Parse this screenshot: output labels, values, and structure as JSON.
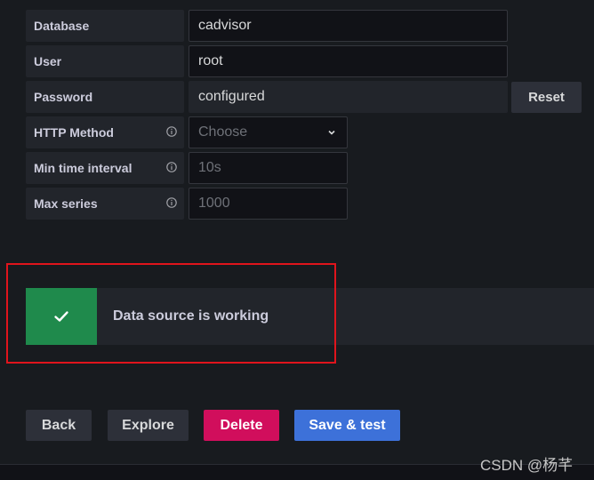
{
  "form": {
    "rows": [
      {
        "label": "Database",
        "value": "cadvisor"
      },
      {
        "label": "User",
        "value": "root"
      },
      {
        "label": "Password",
        "value": "configured"
      },
      {
        "label": "HTTP Method",
        "value": "Choose"
      },
      {
        "label": "Min time interval",
        "value": "10s"
      },
      {
        "label": "Max series",
        "value": "1000"
      }
    ],
    "reset_label": "Reset"
  },
  "alert": {
    "message": "Data source is working",
    "status_color": "#1f8a4c"
  },
  "actions": {
    "back": "Back",
    "explore": "Explore",
    "delete": "Delete",
    "save_test": "Save & test"
  },
  "watermark": "CSDN @杨芊",
  "icons": {
    "info": "info-circle-icon",
    "dropdown": "chevron-down-icon",
    "success": "check-icon"
  },
  "colors": {
    "highlight_box": "#e0141c",
    "delete_button": "#d10e5c",
    "primary_button": "#3d71d9"
  }
}
